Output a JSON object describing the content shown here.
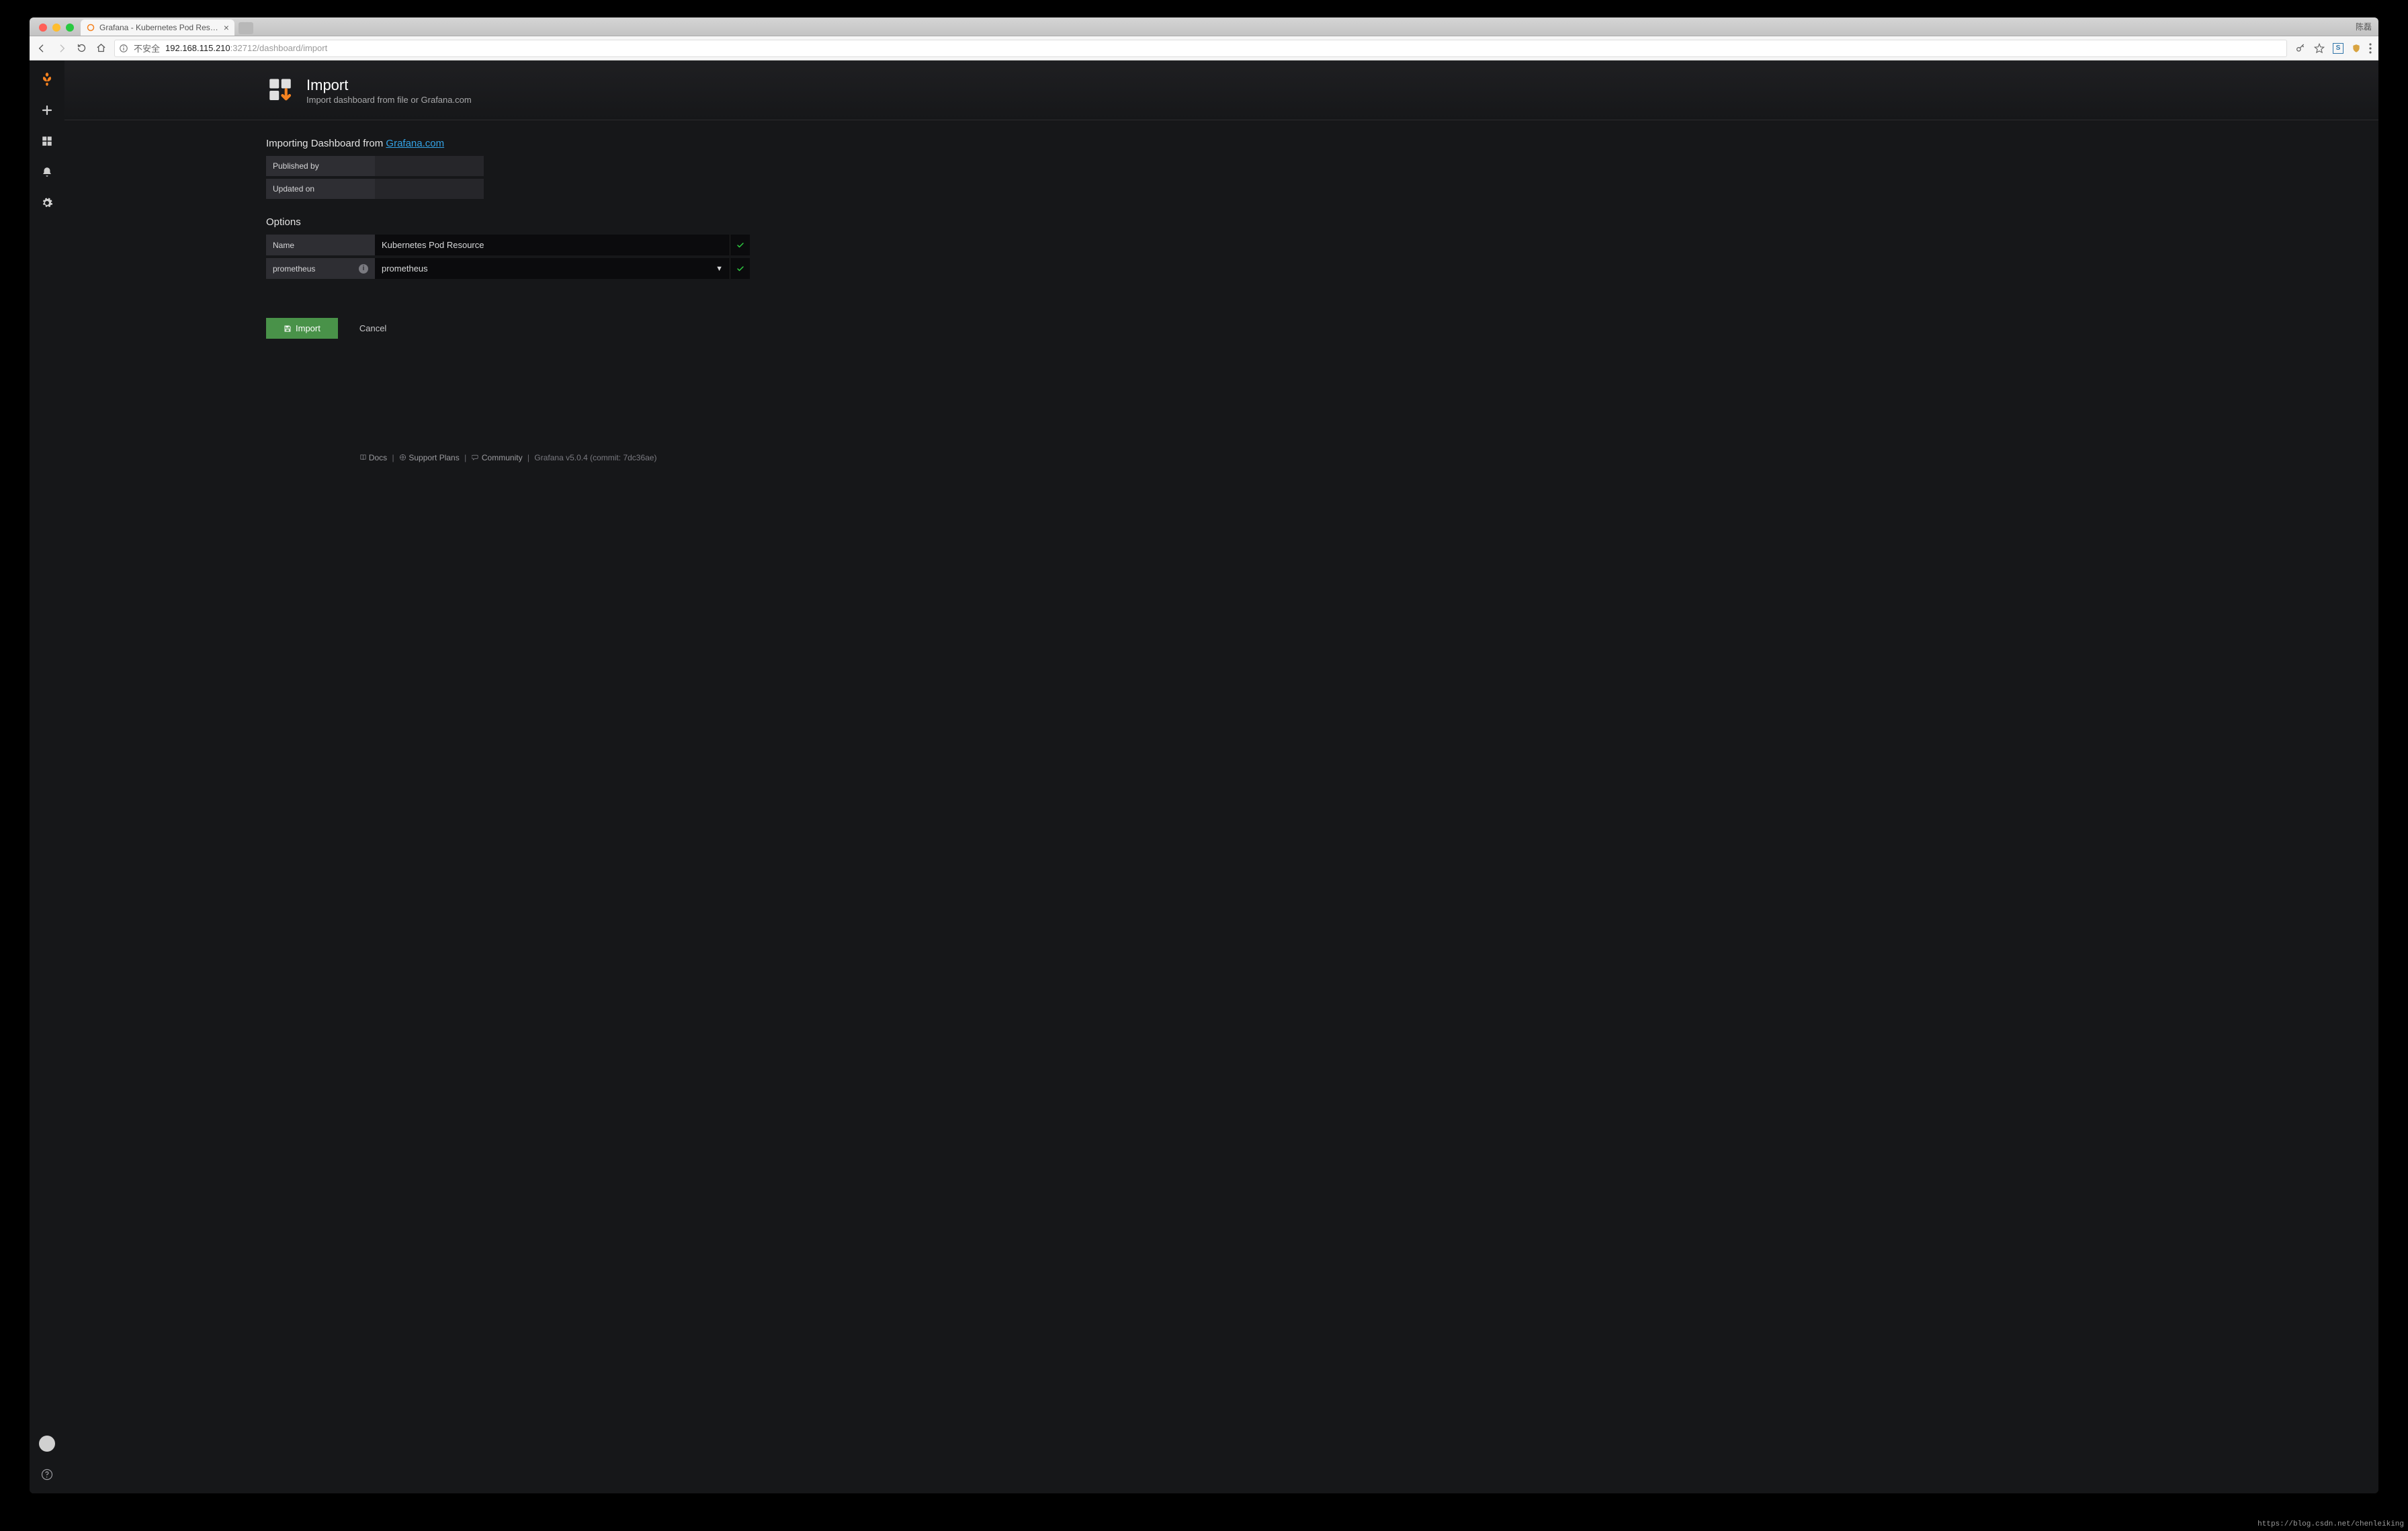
{
  "browser": {
    "user_label": "陈磊",
    "tab_title": "Grafana - Kubernetes Pod Res…",
    "insecure_label": "不安全",
    "url_host": "192.168.115.210",
    "url_path": ":32712/dashboard/import"
  },
  "header": {
    "title": "Import",
    "subtitle": "Import dashboard from file or Grafana.com"
  },
  "importing": {
    "prefix": "Importing Dashboard from ",
    "link_label": "Grafana.com",
    "meta": {
      "published_by_label": "Published by",
      "updated_on_label": "Updated on"
    }
  },
  "options": {
    "heading": "Options",
    "name_label": "Name",
    "name_value": "Kubernetes Pod Resource",
    "datasource_label": "prometheus",
    "datasource_value": "prometheus"
  },
  "actions": {
    "import_label": "Import",
    "cancel_label": "Cancel"
  },
  "footer": {
    "docs": "Docs",
    "support": "Support Plans",
    "community": "Community",
    "version_text": "Grafana v5.0.4 (commit: 7dc36ae)"
  },
  "watermark": "https://blog.csdn.net/chenleiking"
}
